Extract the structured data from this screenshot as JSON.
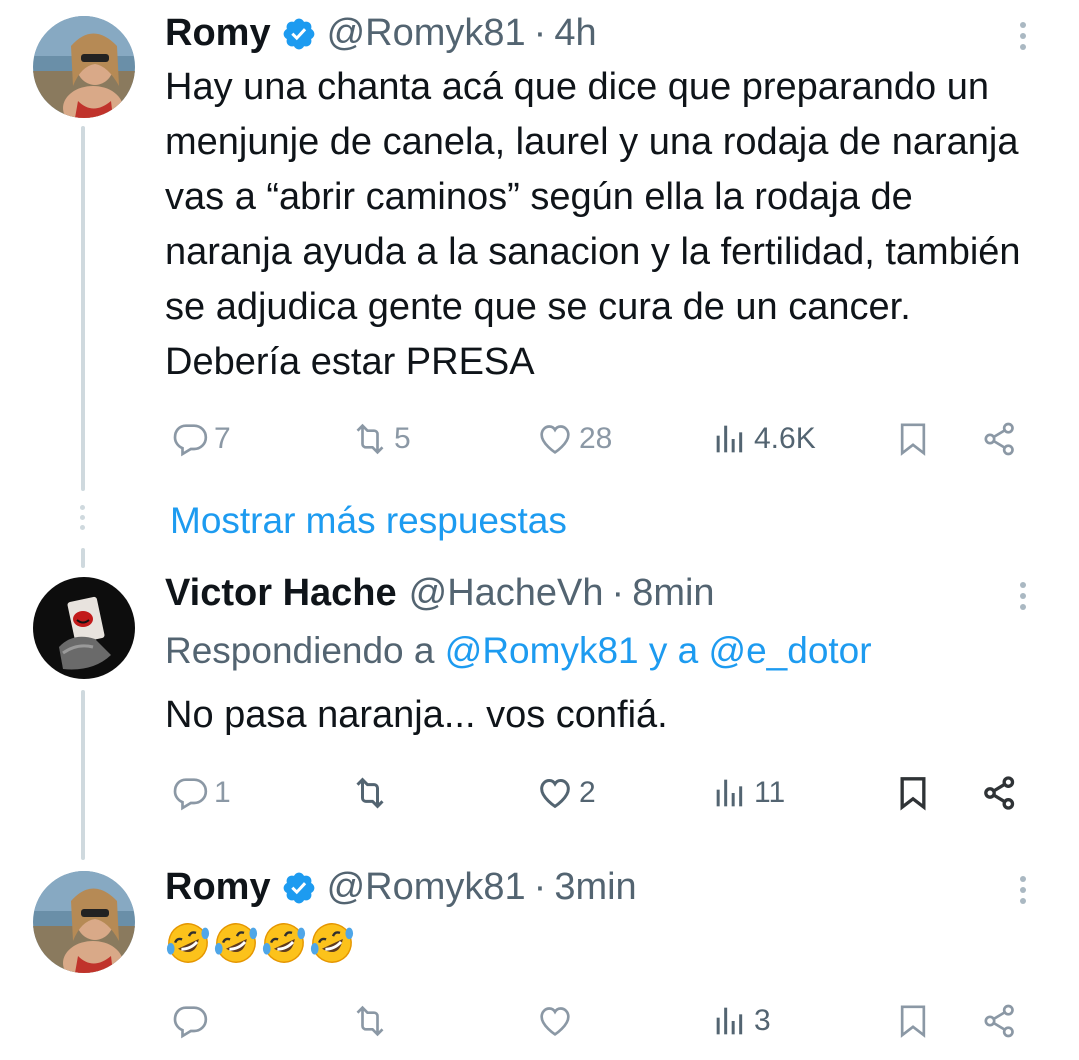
{
  "tweets": [
    {
      "name": "Romy",
      "handle": "@Romyk81",
      "time": "4h",
      "text": "Hay una chanta acá que dice que preparando un menjunje de canela, laurel y una rodaja de naranja vas a “abrir caminos” según ella la rodaja de naranja ayuda a la sanacion y la fertilidad, también se adjudica gente que se cura de un cancer. Debería estar PRESA",
      "replies": "7",
      "retweets": "5",
      "likes": "28",
      "views": "4.6K"
    },
    {
      "name": "Victor Hache",
      "handle": "@HacheVh",
      "time": "8min",
      "replying_prefix": "Respondiendo a",
      "replying_mentions": "@Romyk81 y a @e_dotor",
      "text": "No pasa naranja... vos confiá.",
      "replies": "1",
      "retweets": "",
      "likes": "2",
      "views": "11"
    },
    {
      "name": "Romy",
      "handle": "@Romyk81",
      "time": "3min",
      "text": "🤣🤣🤣🤣",
      "replies": "",
      "retweets": "",
      "likes": "",
      "views": "3"
    }
  ],
  "show_more_label": "Mostrar más respuestas",
  "separator": "·",
  "colors": {
    "accent": "#1d9bf0",
    "muted": "#536471",
    "light": "#8b98a5",
    "thread": "#cfd9de"
  },
  "icons": [
    "verified-badge-icon",
    "more-options-icon",
    "reply-icon",
    "retweet-icon",
    "like-icon",
    "views-icon",
    "bookmark-icon",
    "share-icon",
    "rolling-laughing-emoji"
  ]
}
